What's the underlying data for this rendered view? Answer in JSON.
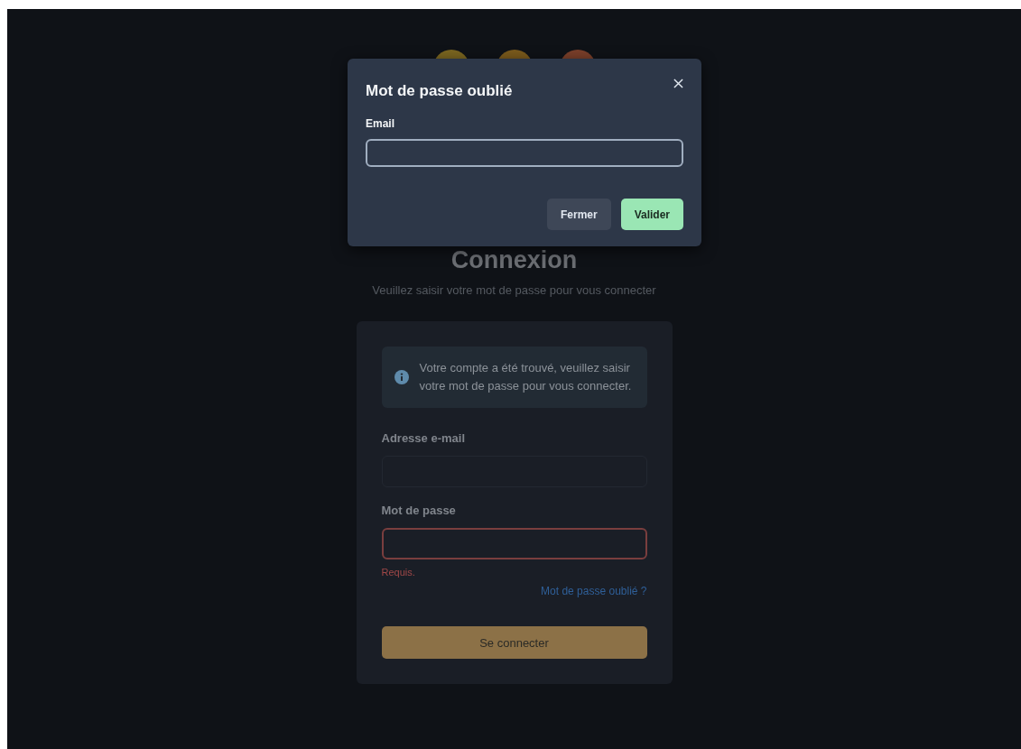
{
  "page": {
    "title": "Connexion",
    "subtitle": "Veuillez saisir votre mot de passe pour vous connecter"
  },
  "login_card": {
    "alert": "Votre compte a été trouvé, veuillez saisir votre mot de passe pour vous connecter.",
    "fields": [
      {
        "label": "Adresse e-mail",
        "invalid": false
      },
      {
        "label": "Mot de passe",
        "invalid": true,
        "error": "Requis."
      }
    ],
    "forgot_link": "Mot de passe oublié ?",
    "submit": "Se connecter"
  },
  "modal": {
    "title": "Mot de passe oublié",
    "field_label": "Email",
    "buttons": [
      {
        "label": "Fermer",
        "kind": "secondary"
      },
      {
        "label": "Valider",
        "kind": "primary"
      }
    ]
  }
}
